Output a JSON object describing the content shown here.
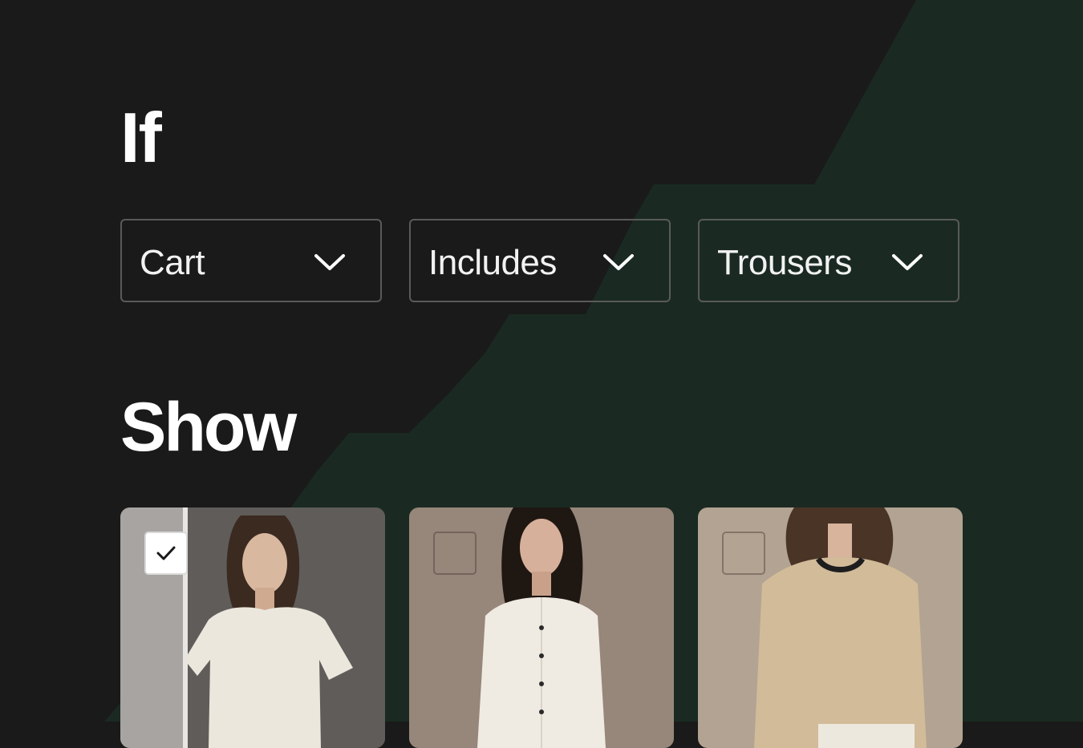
{
  "condition": {
    "heading": "If",
    "dropdowns": [
      {
        "value": "Cart"
      },
      {
        "value": "Includes"
      },
      {
        "value": "Trousers"
      }
    ]
  },
  "result": {
    "heading": "Show",
    "products": [
      {
        "selected": true,
        "image": "model-white-tshirt"
      },
      {
        "selected": false,
        "image": "model-linen-shirt"
      },
      {
        "selected": false,
        "image": "model-beige-sweater"
      }
    ]
  },
  "colors": {
    "background": "#1a1a1a",
    "accent_shape": "#1a2a22",
    "border": "#5a5a5a",
    "text": "#ffffff"
  },
  "icons": {
    "dropdown": "chevron-down-icon",
    "check": "checkmark-icon"
  }
}
